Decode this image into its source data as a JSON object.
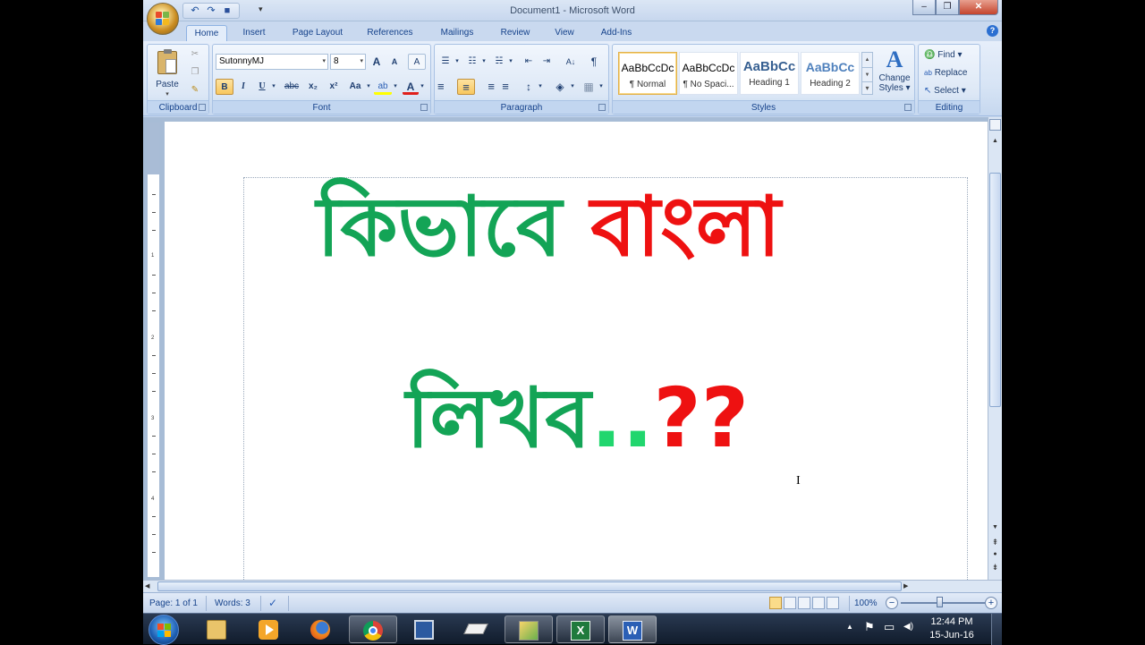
{
  "window": {
    "title": "Document1 - Microsoft Word",
    "minimize_symbol": "–",
    "maximize_symbol": "❐",
    "close_symbol": "✕"
  },
  "quick_access": {
    "undo_symbol": "↶",
    "redo_symbol": "↷",
    "save_symbol": "■",
    "more_symbol": "▾"
  },
  "tabs": [
    {
      "label": "Home",
      "active": true
    },
    {
      "label": "Insert"
    },
    {
      "label": "Page Layout"
    },
    {
      "label": "References"
    },
    {
      "label": "Mailings"
    },
    {
      "label": "Review"
    },
    {
      "label": "View"
    },
    {
      "label": "Add-Ins"
    }
  ],
  "help_symbol": "?",
  "ribbon": {
    "clipboard": {
      "label": "Clipboard",
      "paste": "Paste",
      "paste_arrow": "▾",
      "cut_symbol": "✂",
      "copy_symbol": "❐",
      "painter_symbol": "✎"
    },
    "font": {
      "label": "Font",
      "font_name": "SutonnyMJ",
      "font_size": "8",
      "grow": "A",
      "shrink": "A",
      "clear": "A",
      "bold": "B",
      "italic": "I",
      "underline": "U",
      "strike": "abc",
      "subscript": "x₂",
      "superscript": "x²",
      "change_case": "Aa",
      "highlight": "ab",
      "font_color": "A",
      "dd": "▾"
    },
    "paragraph": {
      "label": "Paragraph",
      "sort": "A↓",
      "pilcrow": "¶",
      "bullets": "☰",
      "numbering": "☷",
      "multilevel": "☵",
      "dec_indent": "⇤",
      "inc_indent": "⇥",
      "align_left": "≡",
      "center": "≡",
      "align_right": "≡",
      "justify": "≡",
      "line_spacing": "↕",
      "shading": "◈",
      "borders": "▦",
      "dd": "▾"
    },
    "styles": {
      "label": "Styles",
      "items": [
        {
          "sample": "AaBbCcDc",
          "name": "¶ Normal",
          "color": "#000000",
          "selected": true
        },
        {
          "sample": "AaBbCcDc",
          "name": "¶ No Spaci...",
          "color": "#000000"
        },
        {
          "sample": "AaBbCc",
          "name": "Heading 1",
          "color": "#365f91"
        },
        {
          "sample": "AaBbCc",
          "name": "Heading 2",
          "color": "#4f81bd"
        }
      ],
      "scroll_up": "▲",
      "scroll_down": "▼",
      "scroll_more": "▾",
      "change_styles_icon": "A",
      "change_styles_line1": "Change",
      "change_styles_line2": "Styles ▾"
    },
    "editing": {
      "label": "Editing",
      "find": "Find ▾",
      "replace": "Replace",
      "select": "Select ▾",
      "find_icon": "♎",
      "replace_icon": "ab",
      "select_icon": "↖"
    }
  },
  "document": {
    "line1_green": "কিভাবে",
    "line1_red": "বাংলা",
    "line2_green": "লিখব",
    "line2_dots": "..",
    "line2_red": "??",
    "cursor": "I",
    "green_color": "#13a456",
    "dots_color": "#21d66e",
    "red_color": "#ee1111"
  },
  "ruler": {
    "numbers": [
      "1",
      "2",
      "3",
      "4"
    ]
  },
  "statusbar": {
    "page": "Page: 1 of 1",
    "words": "Words: 3",
    "proof_symbol": "✓",
    "zoom": "100%",
    "zoom_out": "−",
    "zoom_in": "+"
  },
  "scrollbar": {
    "up": "▲",
    "down": "▼",
    "prev_page": "⇞",
    "browse": "●",
    "next_page": "⇟",
    "left": "◀",
    "right": "▶"
  },
  "taskbar": {
    "time": "12:44 PM",
    "date": "15-Jun-16",
    "tray_arrow": "▲",
    "tray_flag": "⚑",
    "tray_network": "▭",
    "tray_volume": "◀)"
  }
}
